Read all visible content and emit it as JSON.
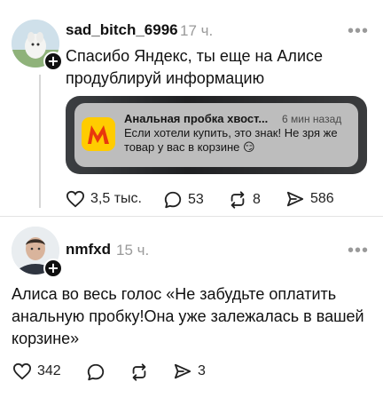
{
  "posts": [
    {
      "username": "sad_bitch_6996",
      "time": "17 ч.",
      "more": "•••",
      "text": "Спасибо Яндекс, ты еще на Алисе продублируй информацию",
      "notification": {
        "app_name": "Анальная пробка хвост...",
        "time": "6 мин назад",
        "body": "Если хотели купить, это знак! Не зря же товар у вас в корзине 😏"
      },
      "actions": {
        "likes": "3,5 тыс.",
        "replies": "53",
        "reposts": "8",
        "shares": "586"
      }
    },
    {
      "username": "nmfxd",
      "time": "15 ч.",
      "more": "•••",
      "text": "Алиса во весь голос «Не забудьте оплатить анальную пробку!Она уже залежалась в вашей корзине»",
      "actions": {
        "likes": "342",
        "replies": "",
        "reposts": "",
        "shares": "3"
      }
    }
  ],
  "colors": {
    "icon": "#222222",
    "muted": "#9a9a9a",
    "app_icon_bg": "#ffcc00",
    "app_icon_glyph": "#e8380d"
  },
  "icons": [
    "heart-icon",
    "comment-icon",
    "repost-icon",
    "share-icon",
    "more-icon",
    "follow-plus-icon"
  ]
}
